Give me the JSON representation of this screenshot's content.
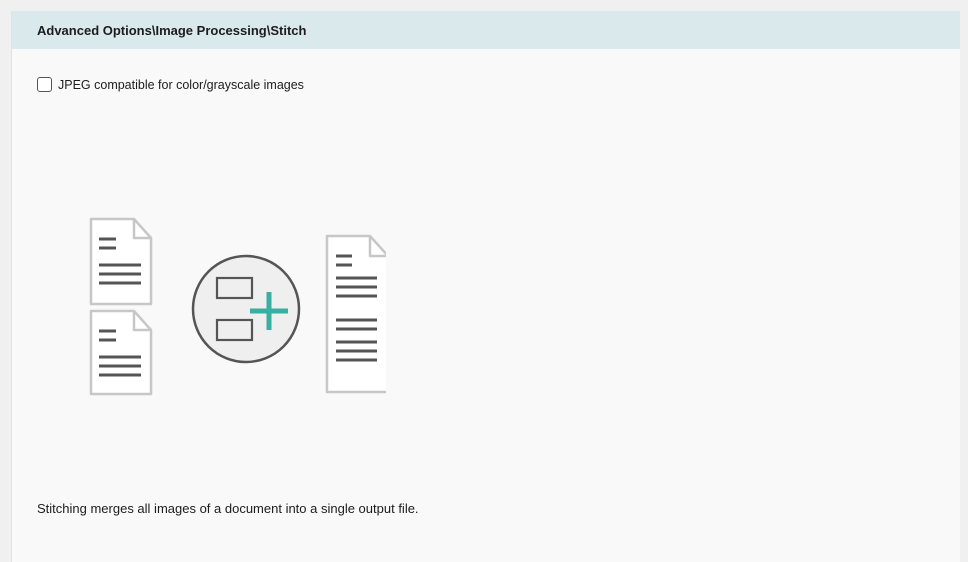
{
  "panel": {
    "title": "Advanced Options\\Image Processing\\Stitch"
  },
  "options": {
    "jpeg_compatible": {
      "label": "JPEG compatible for color/grayscale images",
      "checked": false
    }
  },
  "illustration": {
    "icon": "stitch-illustration-icon",
    "accent_color": "#3aaea0"
  },
  "description": "Stitching merges all images of a document into a single output file."
}
